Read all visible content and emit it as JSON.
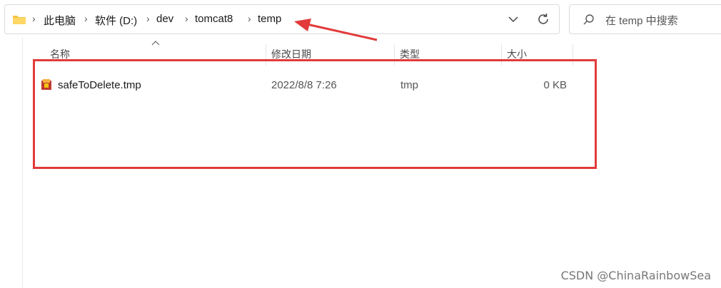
{
  "address_bar": {
    "breadcrumb": [
      "此电脑",
      "软件 (D:)",
      "dev",
      "tomcat8",
      "temp"
    ]
  },
  "search": {
    "placeholder": "在 temp 中搜索"
  },
  "columns": {
    "name": "名称",
    "modified": "修改日期",
    "type": "类型",
    "size": "大小"
  },
  "files": [
    {
      "name": "safeToDelete.tmp",
      "modified": "2022/8/8 7:26",
      "type": "tmp",
      "size": "0 KB"
    }
  ],
  "annotation": {
    "color": "#e23a3a"
  },
  "watermark": "CSDN @ChinaRainbowSea",
  "icons": {
    "folder": "folder-icon",
    "chevron": "chevron-right-icon",
    "dropdown": "chevron-down-icon",
    "refresh": "refresh-icon",
    "search": "search-icon",
    "file": "tmp-file-icon"
  }
}
